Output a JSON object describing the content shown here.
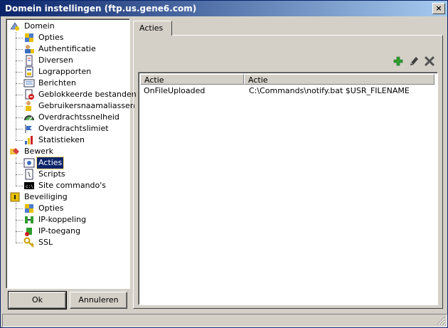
{
  "window": {
    "title": "Domein instellingen (ftp.us.gene6.com)",
    "close_label": "×"
  },
  "tree": {
    "sections": [
      {
        "label": "Domein",
        "icon": "domain-icon",
        "children": [
          {
            "label": "Opties",
            "icon": "options-icon"
          },
          {
            "label": "Authentificatie",
            "icon": "authentication-icon"
          },
          {
            "label": "Diversen",
            "icon": "misc-icon"
          },
          {
            "label": "Lograpporten",
            "icon": "log-reports-icon"
          },
          {
            "label": "Berichten",
            "icon": "messages-icon"
          },
          {
            "label": "Geblokkeerde bestanden",
            "icon": "blocked-files-icon"
          },
          {
            "label": "Gebruikersnaamaliassen",
            "icon": "user-aliases-icon"
          },
          {
            "label": "Overdrachtssnelheid",
            "icon": "transfer-speed-icon"
          },
          {
            "label": "Overdrachtslimiet",
            "icon": "transfer-limit-icon"
          },
          {
            "label": "Statistieken",
            "icon": "statistics-icon"
          }
        ]
      },
      {
        "label": "Bewerk",
        "icon": "edit-icon",
        "children": [
          {
            "label": "Acties",
            "icon": "actions-icon",
            "selected": true
          },
          {
            "label": "Scripts",
            "icon": "scripts-icon"
          },
          {
            "label": "Site commando's",
            "icon": "site-commands-icon"
          }
        ]
      },
      {
        "label": "Beveiliging",
        "icon": "security-icon",
        "children": [
          {
            "label": "Opties",
            "icon": "options-icon"
          },
          {
            "label": "IP-koppeling",
            "icon": "ip-binding-icon"
          },
          {
            "label": "IP-toegang",
            "icon": "ip-access-icon"
          },
          {
            "label": "SSL",
            "icon": "ssl-key-icon"
          }
        ]
      }
    ]
  },
  "buttons": {
    "ok": "Ok",
    "cancel": "Annuleren"
  },
  "tab": {
    "label": "Acties"
  },
  "toolbar": {
    "add_icon": "plus-icon",
    "edit_icon": "pencil-icon",
    "delete_icon": "x-icon"
  },
  "table": {
    "columns": [
      "Actie",
      "Actie"
    ],
    "rows": [
      [
        "OnFileUploaded",
        "C:\\Commands\\notify.bat $USR_FILENAME"
      ]
    ]
  },
  "colors": {
    "title_start": "#0a246a",
    "title_end": "#a6caf0",
    "face": "#d4d0c8",
    "selection": "#0a246a",
    "add_green": "#2e9e2e"
  }
}
